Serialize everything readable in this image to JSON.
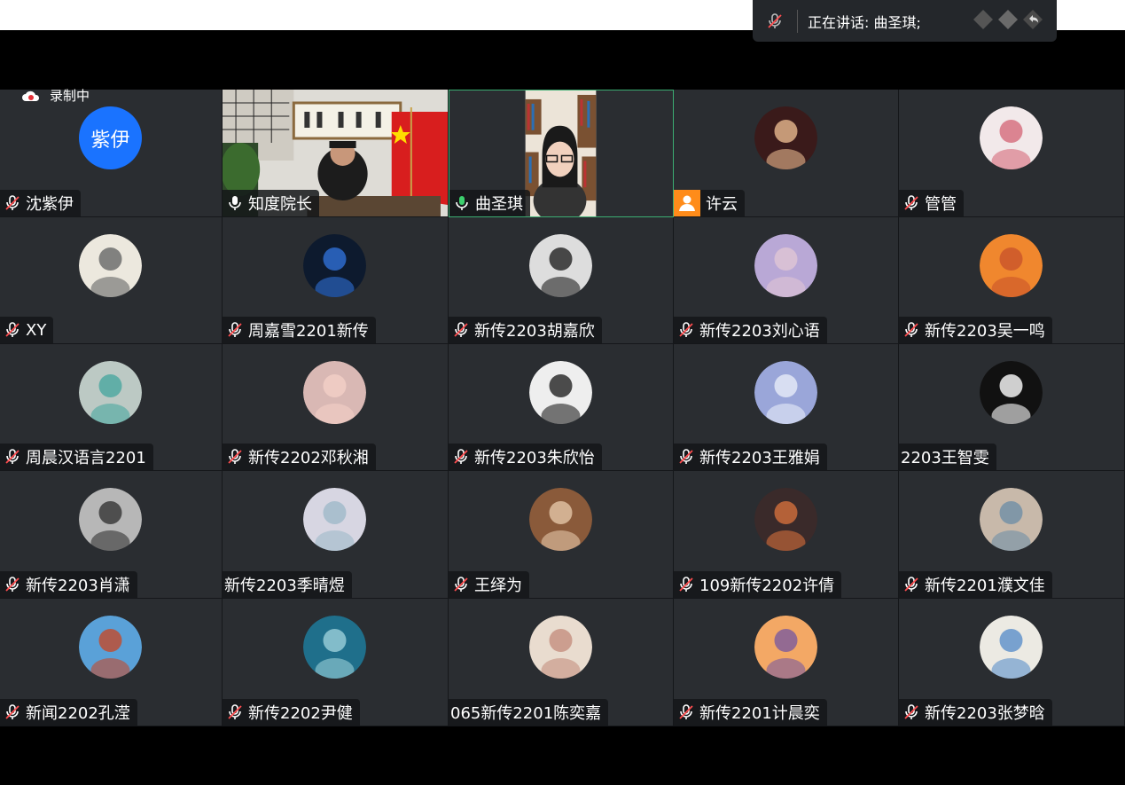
{
  "window": {
    "recording_label": "录制中"
  },
  "speaker_bar": {
    "label": "正在讲话: 曲圣琪;"
  },
  "colors": {
    "tile_bg": "#2a2d31",
    "active_border": "#3cae73",
    "accent": "#1a73ff",
    "mic_on": "#3ccf6e",
    "muted_mic": "#ffffff",
    "person_badge": "#ff8c1a"
  },
  "tiles": [
    {
      "name": "沈紫伊",
      "mic": "muted",
      "avatar_text": "紫伊"
    },
    {
      "name": "知度院长",
      "mic": "on-white",
      "video": true
    },
    {
      "name": "曲圣琪",
      "mic": "on-green",
      "video": true,
      "active": true
    },
    {
      "name": "许云",
      "mic": "person"
    },
    {
      "name": "管管",
      "mic": "muted"
    },
    {
      "name": "XY",
      "mic": "muted"
    },
    {
      "name": "周嘉雪2201新传",
      "mic": "muted"
    },
    {
      "name": "新传2203胡嘉欣",
      "mic": "muted"
    },
    {
      "name": "新传2203刘心语",
      "mic": "muted"
    },
    {
      "name": "新传2203吴一鸣",
      "mic": "muted"
    },
    {
      "name": "周晨汉语言2201",
      "mic": "muted"
    },
    {
      "name": "新传2202邓秋湘",
      "mic": "muted"
    },
    {
      "name": "新传2203朱欣怡",
      "mic": "muted"
    },
    {
      "name": "新传2203王雅娟",
      "mic": "muted"
    },
    {
      "name": "2203王智雯",
      "mic": "none"
    },
    {
      "name": "新传2203肖潇",
      "mic": "muted"
    },
    {
      "name": "新传2203季晴煜",
      "mic": "none"
    },
    {
      "name": "王绎为",
      "mic": "muted"
    },
    {
      "name": "109新传2202许倩",
      "mic": "muted"
    },
    {
      "name": "新传2201濮文佳",
      "mic": "muted"
    },
    {
      "name": "新闻2202孔滢",
      "mic": "muted"
    },
    {
      "name": "新传2202尹健",
      "mic": "muted"
    },
    {
      "name": "065新传2201陈奕嘉",
      "mic": "none"
    },
    {
      "name": "新传2201计晨奕",
      "mic": "muted"
    },
    {
      "name": "新传2203张梦晗",
      "mic": "muted"
    }
  ]
}
